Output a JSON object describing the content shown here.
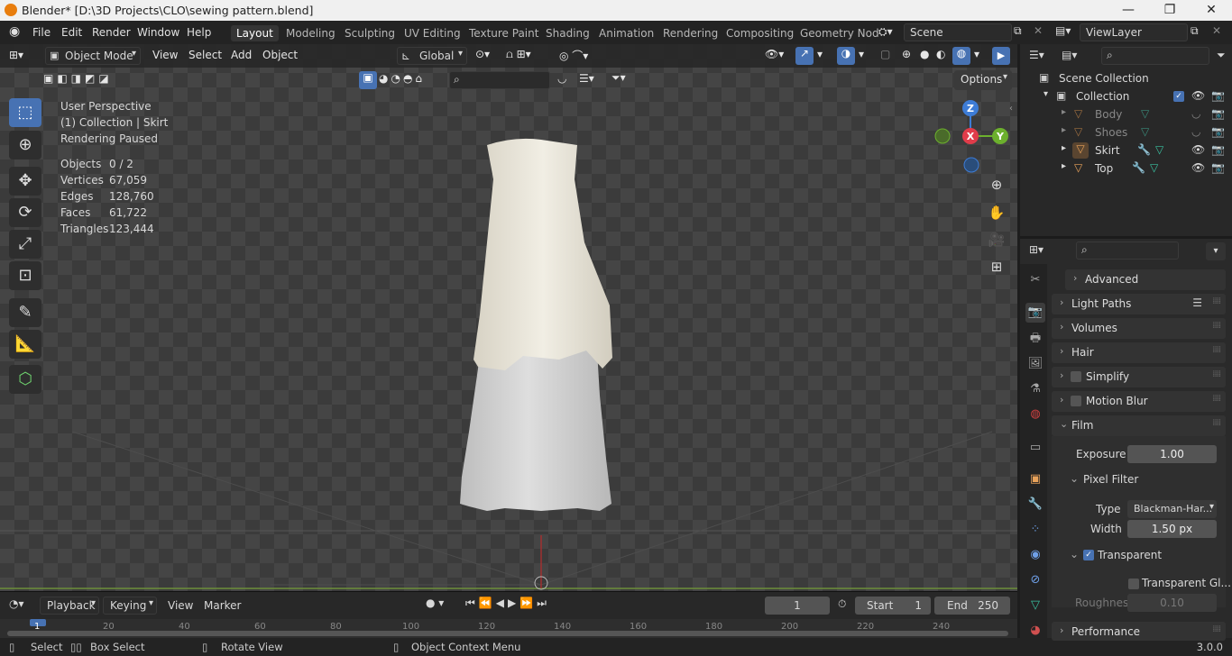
{
  "window": {
    "title": "Blender* [D:\\3D Projects\\CLO\\sewing pattern.blend]",
    "minimize": "—",
    "maximize": "❐",
    "close": "✕"
  },
  "menu": {
    "items": [
      "File",
      "Edit",
      "Render",
      "Window",
      "Help"
    ],
    "workspaces": [
      "Layout",
      "Modeling",
      "Sculpting",
      "UV Editing",
      "Texture Paint",
      "Shading",
      "Animation",
      "Rendering",
      "Compositing",
      "Geometry Nod"
    ],
    "active_workspace": "Layout",
    "scene": "Scene",
    "view_layer": "ViewLayer"
  },
  "viewport_header": {
    "mode": "Object Mode",
    "menus": [
      "View",
      "Select",
      "Add",
      "Object"
    ],
    "orientation": "Global",
    "options": "Options"
  },
  "overlay_text": {
    "perspective": "User Perspective",
    "collection": "(1) Collection | Skirt",
    "render_status": "Rendering Paused",
    "stats": [
      {
        "label": "Objects",
        "value": "0 / 2"
      },
      {
        "label": "Vertices",
        "value": "67,059"
      },
      {
        "label": "Edges",
        "value": "128,760"
      },
      {
        "label": "Faces",
        "value": "61,722"
      },
      {
        "label": "Triangles",
        "value": "123,444"
      }
    ]
  },
  "gizmo": {
    "z": "Z",
    "y": "Y",
    "x": "X"
  },
  "timeline": {
    "menus": [
      "Playback",
      "Keying",
      "View",
      "Marker"
    ],
    "current_frame": "1",
    "start_label": "Start",
    "start": "1",
    "end_label": "End",
    "end": "250",
    "ruler": [
      "1",
      "20",
      "40",
      "60",
      "80",
      "100",
      "120",
      "140",
      "160",
      "180",
      "200",
      "220",
      "240"
    ]
  },
  "status_bar": {
    "select": "Select",
    "box_select": "Box Select",
    "rotate_view": "Rotate View",
    "context_menu": "Object Context Menu",
    "version": "3.0.0"
  },
  "outliner": {
    "scene_collection": "Scene Collection",
    "collection": "Collection",
    "objects": [
      {
        "name": "Body",
        "dim": true
      },
      {
        "name": "Shoes",
        "dim": true
      },
      {
        "name": "Skirt",
        "dim": false
      },
      {
        "name": "Top",
        "dim": false
      }
    ]
  },
  "properties": {
    "panels": {
      "advanced": "Advanced",
      "light_paths": "Light Paths",
      "volumes": "Volumes",
      "hair": "Hair",
      "simplify": "Simplify",
      "motion_blur": "Motion Blur",
      "film": "Film",
      "exposure_label": "Exposure",
      "exposure": "1.00",
      "pixel_filter": "Pixel Filter",
      "type_label": "Type",
      "type": "Blackman-Har...",
      "width_label": "Width",
      "width": "1.50 px",
      "transparent": "Transparent",
      "transparent_glass": "Transparent Gl...",
      "roughness_label": "Roughness ...",
      "roughness": "0.10",
      "performance": "Performance"
    }
  },
  "colors": {
    "accent": "#4772b3",
    "axis_x": "#e03c4a",
    "axis_y": "#6cb02d",
    "axis_z": "#3d7cd6",
    "object_orange": "#e8a25a"
  }
}
